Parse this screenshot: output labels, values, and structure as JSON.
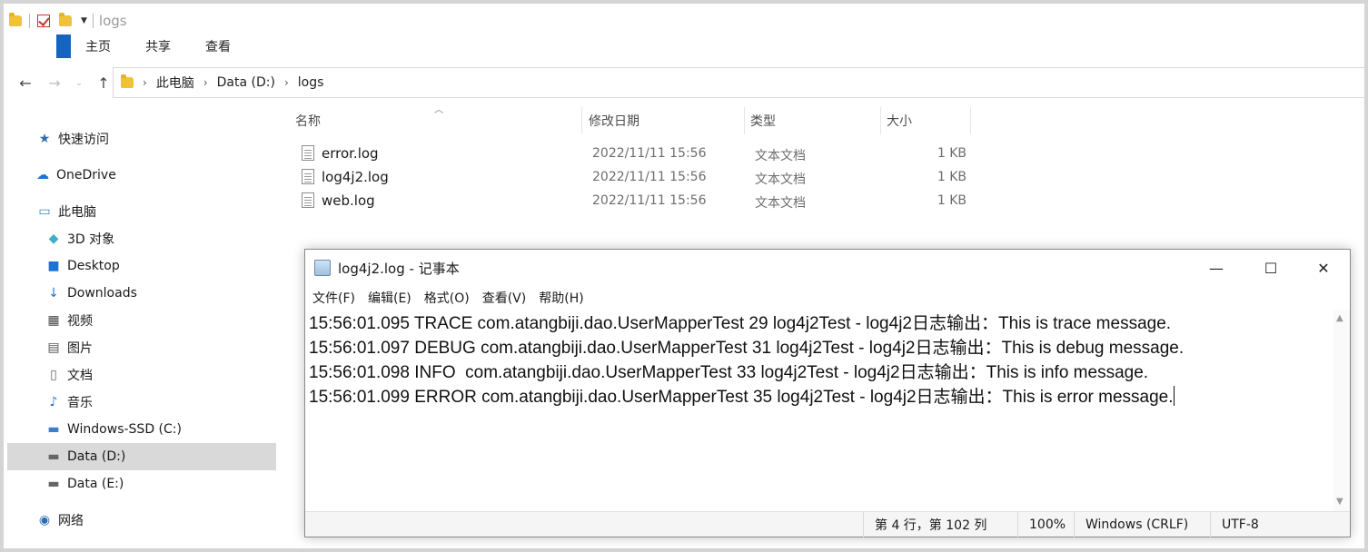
{
  "window": {
    "title": "logs"
  },
  "ribbon": {
    "tabs": [
      "主页",
      "共享",
      "查看"
    ]
  },
  "address": {
    "crumbs": [
      "此电脑",
      "Data (D:)",
      "logs"
    ]
  },
  "sidebar": {
    "items": [
      {
        "label": "快速访问",
        "icon": "star-icon"
      },
      {
        "label": "OneDrive",
        "icon": "cloud-icon"
      },
      {
        "label": "此电脑",
        "icon": "computer-icon"
      },
      {
        "label": "3D 对象",
        "icon": "cube-icon"
      },
      {
        "label": "Desktop",
        "icon": "desktop-icon"
      },
      {
        "label": "Downloads",
        "icon": "download-icon"
      },
      {
        "label": "视频",
        "icon": "video-icon"
      },
      {
        "label": "图片",
        "icon": "picture-icon"
      },
      {
        "label": "文档",
        "icon": "document-icon"
      },
      {
        "label": "音乐",
        "icon": "music-icon"
      },
      {
        "label": "Windows-SSD (C:)",
        "icon": "drive-icon"
      },
      {
        "label": "Data (D:)",
        "icon": "drive-icon",
        "selected": true
      },
      {
        "label": "Data (E:)",
        "icon": "drive-icon"
      },
      {
        "label": "网络",
        "icon": "network-icon"
      }
    ]
  },
  "columns": {
    "name": "名称",
    "modified": "修改日期",
    "type": "类型",
    "size": "大小"
  },
  "files": [
    {
      "name": "error.log",
      "modified": "2022/11/11 15:56",
      "type": "文本文档",
      "size": "1 KB"
    },
    {
      "name": "log4j2.log",
      "modified": "2022/11/11 15:56",
      "type": "文本文档",
      "size": "1 KB"
    },
    {
      "name": "web.log",
      "modified": "2022/11/11 15:56",
      "type": "文本文档",
      "size": "1 KB"
    }
  ],
  "notepad": {
    "title": "log4j2.log - 记事本",
    "menu": [
      "文件(F)",
      "编辑(E)",
      "格式(O)",
      "查看(V)",
      "帮助(H)"
    ],
    "lines": [
      "15:56:01.095 TRACE com.atangbiji.dao.UserMapperTest 29 log4j2Test - log4j2日志输出：This is trace message.",
      "15:56:01.097 DEBUG com.atangbiji.dao.UserMapperTest 31 log4j2Test - log4j2日志输出：This is debug message.",
      "15:56:01.098 INFO  com.atangbiji.dao.UserMapperTest 33 log4j2Test - log4j2日志输出：This is info message.",
      "15:56:01.099 ERROR com.atangbiji.dao.UserMapperTest 35 log4j2Test - log4j2日志输出：This is error message."
    ],
    "status": {
      "position": "第 4 行，第 102 列",
      "zoom": "100%",
      "line_ending": "Windows (CRLF)",
      "encoding": "UTF-8"
    }
  }
}
